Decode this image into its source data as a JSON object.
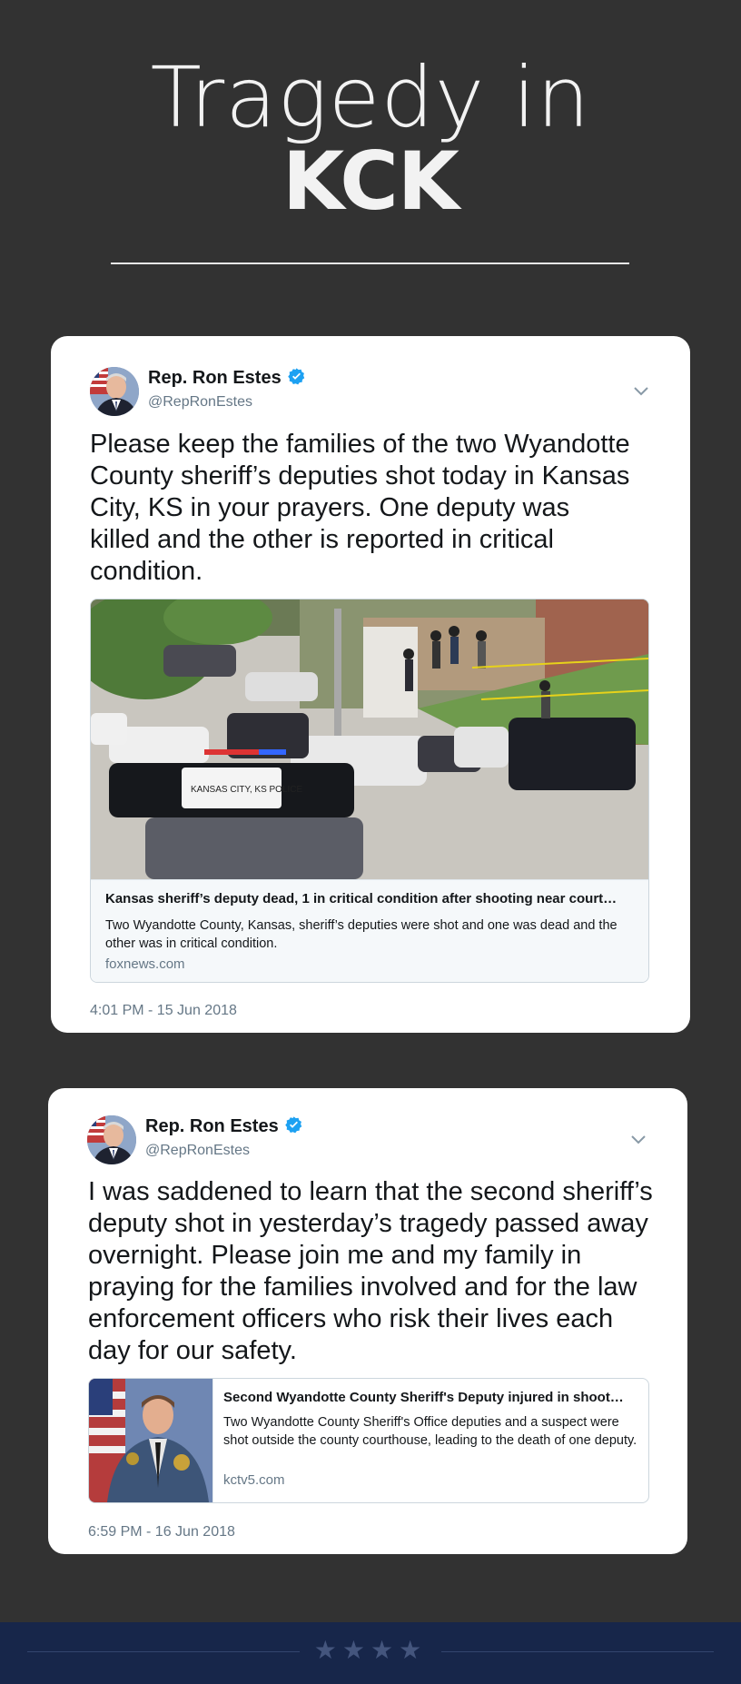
{
  "header": {
    "title_line1": "Tragedy in",
    "title_line2": "KCK"
  },
  "tweets": [
    {
      "author_name": "Rep. Ron Estes",
      "author_handle": "@RepRonEstes",
      "verified": true,
      "text": "Please keep the families of the two Wyandotte County sheriff’s deputies shot today in Kansas City, KS in your prayers. One deputy was killed and the other is reported in critical condition.",
      "link_card": {
        "image": "kansas-city-ks-police-scene-photo",
        "title": "Kansas sheriff’s deputy dead, 1 in critical condition after shooting near court…",
        "description": "Two Wyandotte County, Kansas, sheriff’s deputies were shot and one was dead and the other was in critical condition.",
        "domain": "foxnews.com"
      },
      "timestamp": "4:01 PM - 15 Jun 2018"
    },
    {
      "author_name": "Rep. Ron Estes",
      "author_handle": "@RepRonEstes",
      "verified": true,
      "text": "I was saddened to learn that the second sheriff’s deputy shot in yesterday’s tragedy passed away overnight. Please join me and my family in praying for the families involved and for the law enforcement officers who risk their lives each day for our safety.",
      "link_card": {
        "image": "deputy-portrait-photo",
        "title": "Second Wyandotte County Sheriff's Deputy injured in shoot…",
        "description": "Two Wyandotte County Sheriff's Office deputies and a suspect were shot outside the county courthouse, leading to the death of one deputy.",
        "domain": "kctv5.com"
      },
      "timestamp": "6:59 PM - 16 Jun 2018"
    }
  ],
  "footer": {
    "stars": "★★★★"
  },
  "colors": {
    "background": "#323232",
    "card": "#ffffff",
    "verified_blue": "#1da1f2",
    "footer_navy": "#17264a"
  }
}
